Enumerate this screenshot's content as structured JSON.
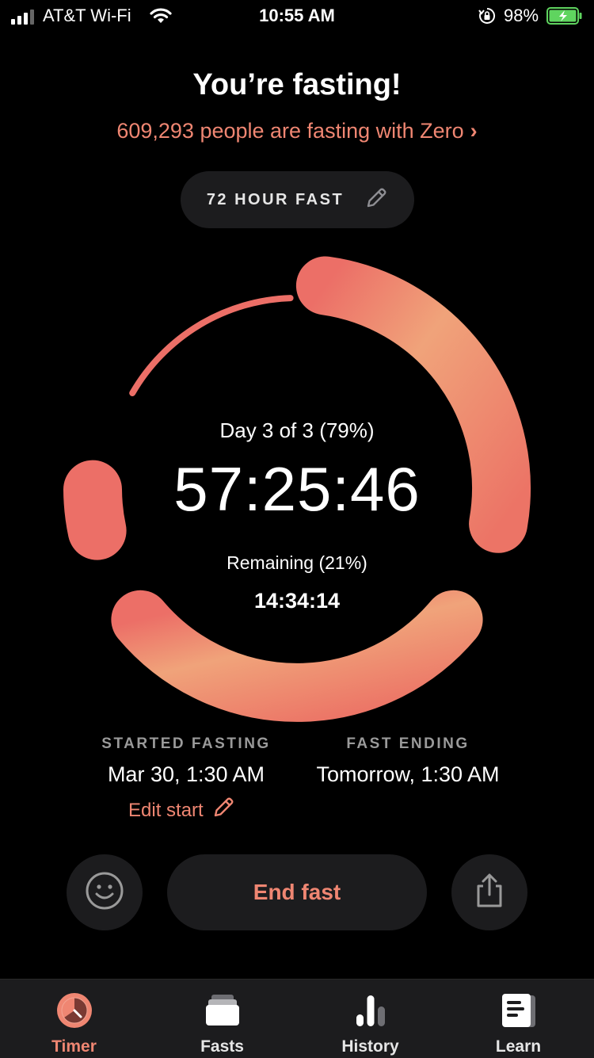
{
  "status_bar": {
    "carrier": "AT&T Wi-Fi",
    "time": "10:55 AM",
    "battery_percent": "98%"
  },
  "header": {
    "title": "You’re fasting!",
    "subtitle": "609,293 people are fasting with Zero",
    "subtitle_chevron": "›"
  },
  "fast_type": {
    "label": "72 HOUR FAST",
    "icon": "pencil-icon"
  },
  "timer": {
    "day_text": "Day 3 of 3 (79%)",
    "elapsed": "57:25:46",
    "remaining_label": "Remaining (21%)",
    "remaining": "14:34:14",
    "progress_fraction": 0.79
  },
  "started": {
    "caption": "STARTED FASTING",
    "value": "Mar 30, 1:30 AM",
    "edit_label": "Edit start"
  },
  "ending": {
    "caption": "FAST ENDING",
    "value": "Tomorrow, 1:30 AM"
  },
  "actions": {
    "end_label": "End fast",
    "mood_icon": "smiley-icon",
    "share_icon": "share-icon"
  },
  "tabs": [
    {
      "label": "Timer",
      "icon": "timer-icon",
      "active": true
    },
    {
      "label": "Fasts",
      "icon": "fasts-icon",
      "active": false
    },
    {
      "label": "History",
      "icon": "history-icon",
      "active": false
    },
    {
      "label": "Learn",
      "icon": "learn-icon",
      "active": false
    }
  ],
  "colors": {
    "accent": "#ef8672",
    "ring_start": "#f0a37a",
    "ring_end": "#ec6f67",
    "background": "#000000",
    "surface": "#1c1c1e"
  }
}
